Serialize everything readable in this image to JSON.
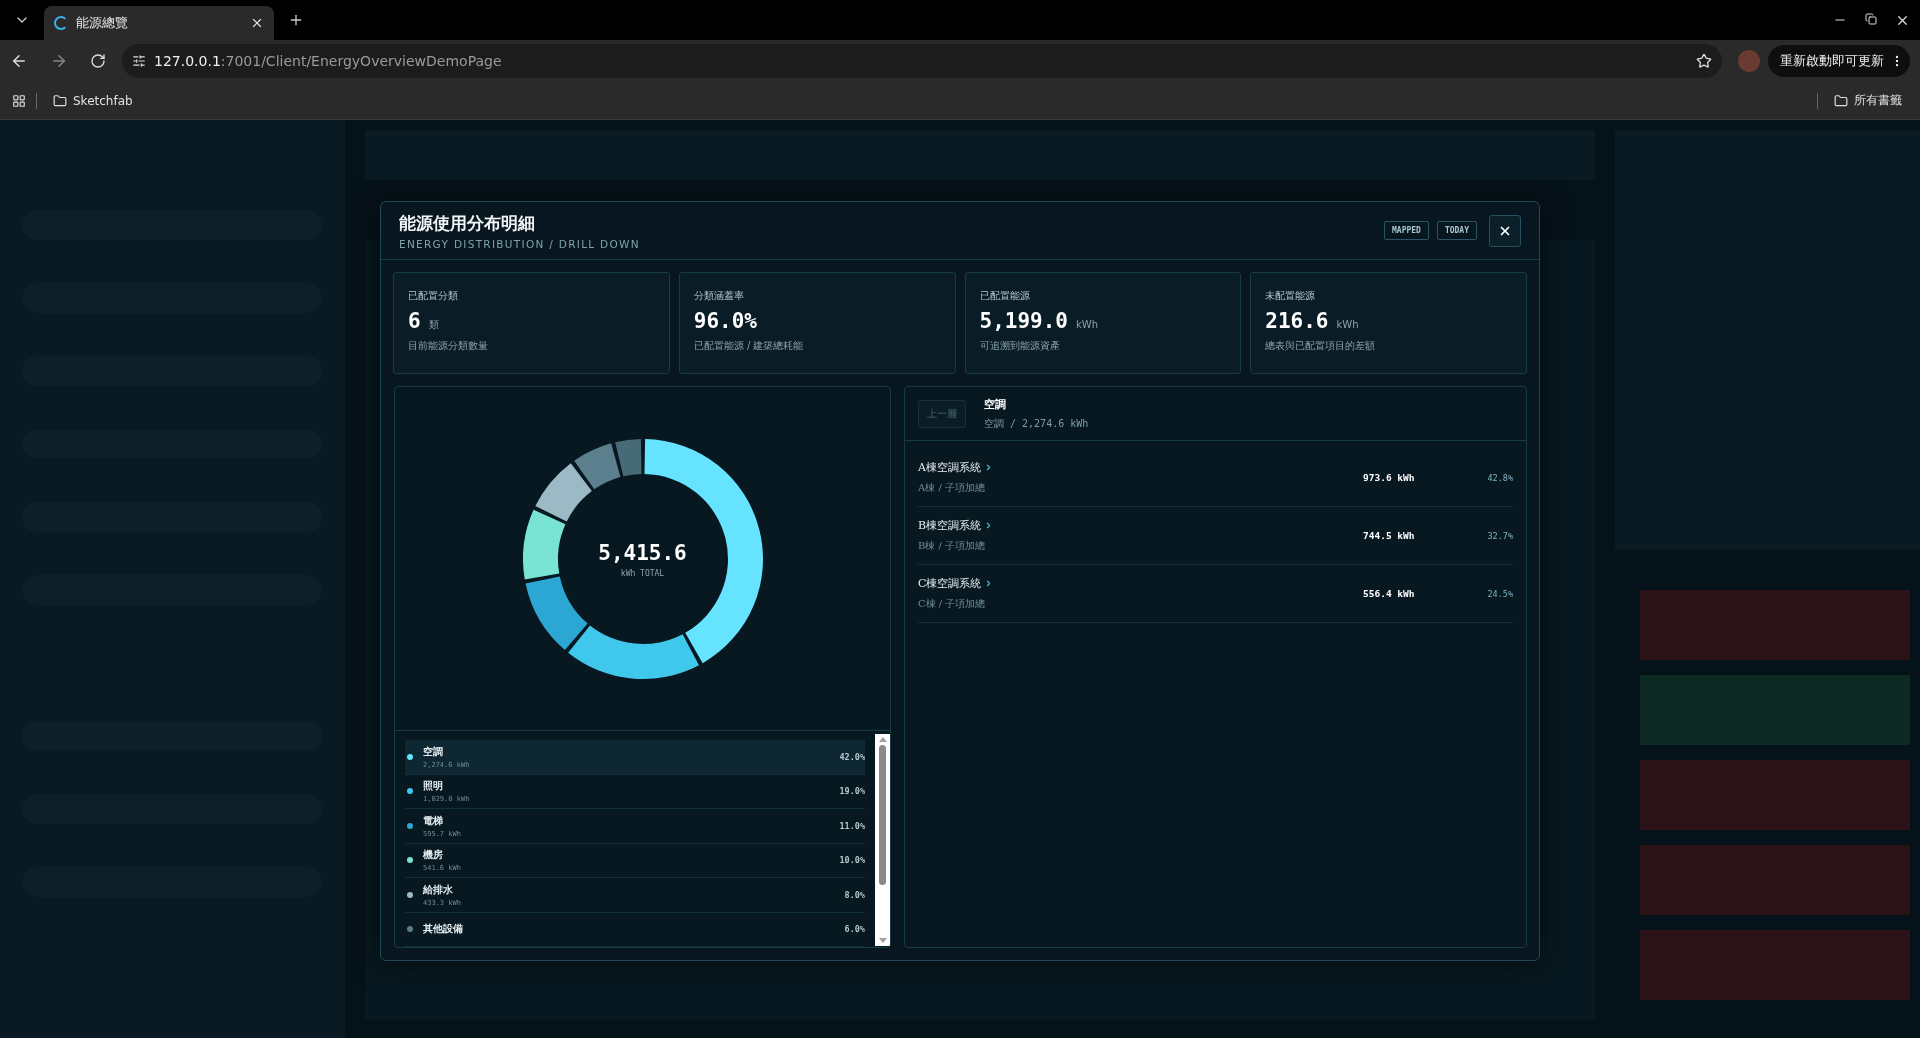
{
  "browser": {
    "tab_title": "能源總覽",
    "url_host": "127.0.0.1",
    "url_path": ":7001/Client/EnergyOverviewDemoPage",
    "update_button": "重新啟動即可更新",
    "bookmarks": [
      {
        "label": "Sketchfab"
      }
    ],
    "all_bookmarks": "所有書籤"
  },
  "modal": {
    "title": "能源使用分布明細",
    "subtitle": "ENERGY DISTRIBUTION / DRILL DOWN",
    "badges": [
      "MAPPED",
      "TODAY"
    ]
  },
  "stats": [
    {
      "label": "已配置分類",
      "value": "6",
      "unit": "類",
      "note": "目前能源分類數量"
    },
    {
      "label": "分類涵蓋率",
      "value": "96.0%",
      "note": "已配置能源 / 建築總耗能"
    },
    {
      "label": "已配置能源",
      "value": "5,199.0",
      "unit": "kWh",
      "note": "可追溯到能源資產"
    },
    {
      "label": "未配置能源",
      "value": "216.6",
      "unit": "kWh",
      "note": "總表與已配置項目的差額"
    }
  ],
  "donut": {
    "total": "5,415.6",
    "caption": "kWh TOTAL",
    "chart_data": {
      "type": "donut",
      "values": [
        42.0,
        19.0,
        11.0,
        10.0,
        8.0,
        6.0,
        4.0
      ],
      "colors": [
        "#66e3ff",
        "#40c8ec",
        "#2ca6d2",
        "#7ae4d4",
        "#9bbac6",
        "#5b7f8c",
        "#476a77"
      ]
    }
  },
  "legend": [
    {
      "name": "空調",
      "kwh": "2,274.6 kWh",
      "pct": "42.0%",
      "color": "#66e3ff",
      "selected": true
    },
    {
      "name": "照明",
      "kwh": "1,029.0 kWh",
      "pct": "19.0%",
      "color": "#40c8ec",
      "selected": false
    },
    {
      "name": "電梯",
      "kwh": "595.7 kWh",
      "pct": "11.0%",
      "color": "#2ca6d2",
      "selected": false
    },
    {
      "name": "機房",
      "kwh": "541.6 kWh",
      "pct": "10.0%",
      "color": "#7ae4d4",
      "selected": false
    },
    {
      "name": "給排水",
      "kwh": "433.3 kWh",
      "pct": "8.0%",
      "color": "#9bbac6",
      "selected": false
    },
    {
      "name": "其他設備",
      "pct": "6.0%",
      "color": "#5b7f8c",
      "selected": false
    }
  ],
  "detail": {
    "back_button": {
      "label": "上一層",
      "disabled": true
    },
    "title": "空調",
    "path": "空調 / 2,274.6 kWh",
    "rows": [
      {
        "name": "A棟空調系統",
        "sub": "A棟 / 子項加總",
        "value": "973.6 kWh",
        "pct": "42.8%"
      },
      {
        "name": "B棟空調系統",
        "sub": "B棟 / 子項加總",
        "value": "744.5 kWh",
        "pct": "32.7%"
      },
      {
        "name": "C棟空調系統",
        "sub": "C棟 / 子項加總",
        "value": "556.4 kWh",
        "pct": "24.5%"
      }
    ]
  }
}
